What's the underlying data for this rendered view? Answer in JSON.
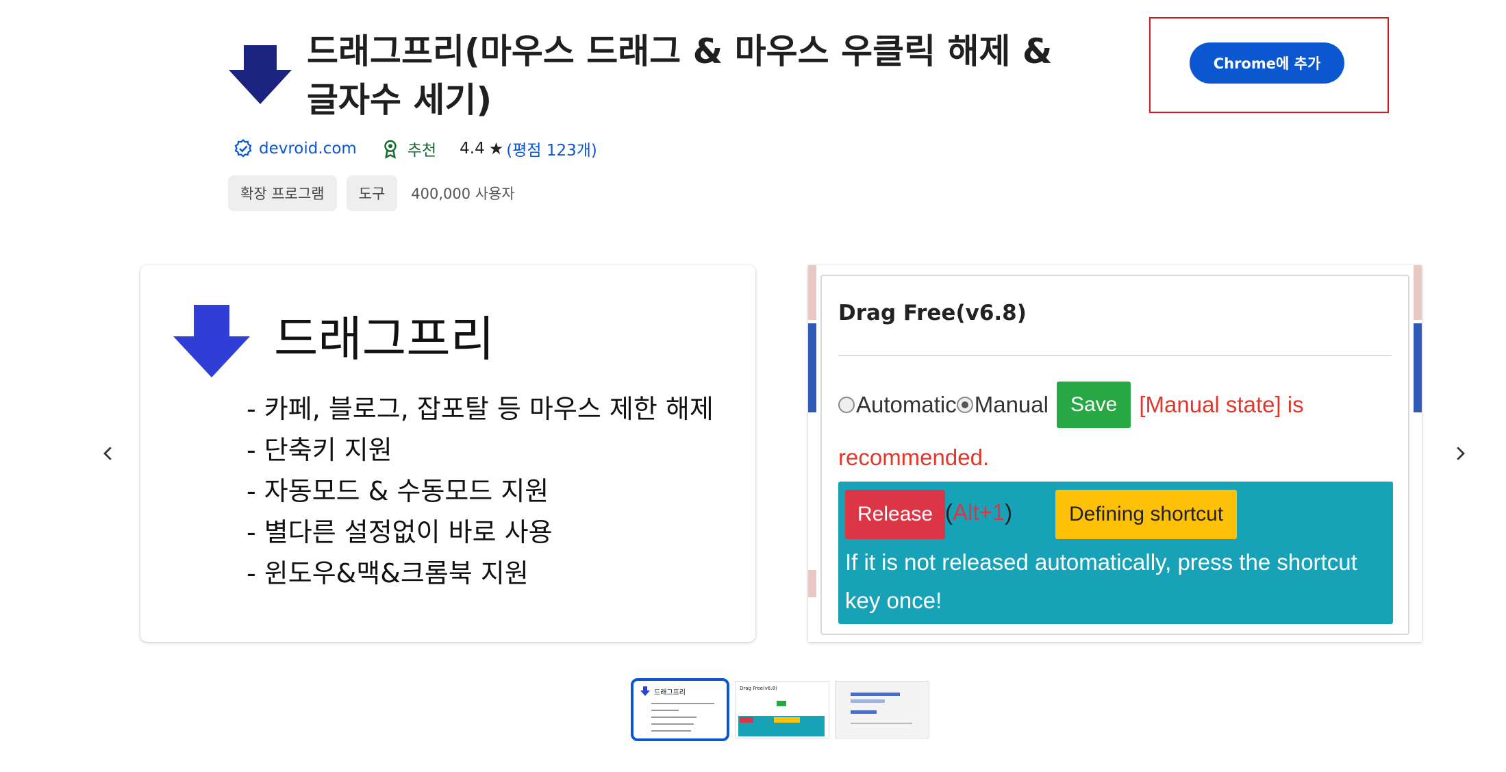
{
  "extension": {
    "title": "드래그프리(마우스 드래그 & 마우스 우클릭 해제 & 글자수 세기)",
    "publisher": "devroid.com",
    "featured_label": "추천",
    "rating_value": "4.4",
    "rating_star": "★",
    "rating_open": "(",
    "ratings_count_label": "평점 123개",
    "rating_close": ")",
    "tags": [
      "확장 프로그램",
      "도구"
    ],
    "users": "400,000 사용자",
    "add_button_label": "Chrome에 추가"
  },
  "colors": {
    "accent": "#0b57d0",
    "featured": "#146c2e",
    "highlight_frame": "#e3141d",
    "logo_dark": "#1a237e",
    "logo_bright": "#2f3fd6"
  },
  "slides": {
    "slide1": {
      "title": "드래그프리",
      "bullets": [
        "- 카페, 블로그, 잡포탈 등 마우스 제한 해제",
        "- 단축키 지원",
        "- 자동모드 & 수동모드 지원",
        "- 별다른 설정없이 바로 사용",
        "- 윈도우&맥&크롬북 지원"
      ]
    },
    "slide2": {
      "popup_title": "Drag Free(v6.8)",
      "radio_automatic": "Automatic",
      "radio_manual": "Manual",
      "save_label": "Save",
      "note_line1": "[Manual state] is",
      "note_line2": "recommended.",
      "release_label": "Release",
      "hotkey_open": "(",
      "hotkey": "Alt+1",
      "hotkey_close": ")",
      "shortcut_label": "Defining shortcut",
      "message": "If it is not released automatically, press the shortcut key once!"
    }
  },
  "thumbnails": {
    "count": 3,
    "active_index": 0,
    "thumb1_title": "드래그프리",
    "thumb2_title": "Drag Free(v6.8)"
  },
  "icons": {
    "logo": "down-arrow-icon",
    "verified": "verified-badge-icon",
    "featured": "award-ribbon-icon",
    "prev": "chevron-left-icon",
    "next": "chevron-right-icon"
  }
}
